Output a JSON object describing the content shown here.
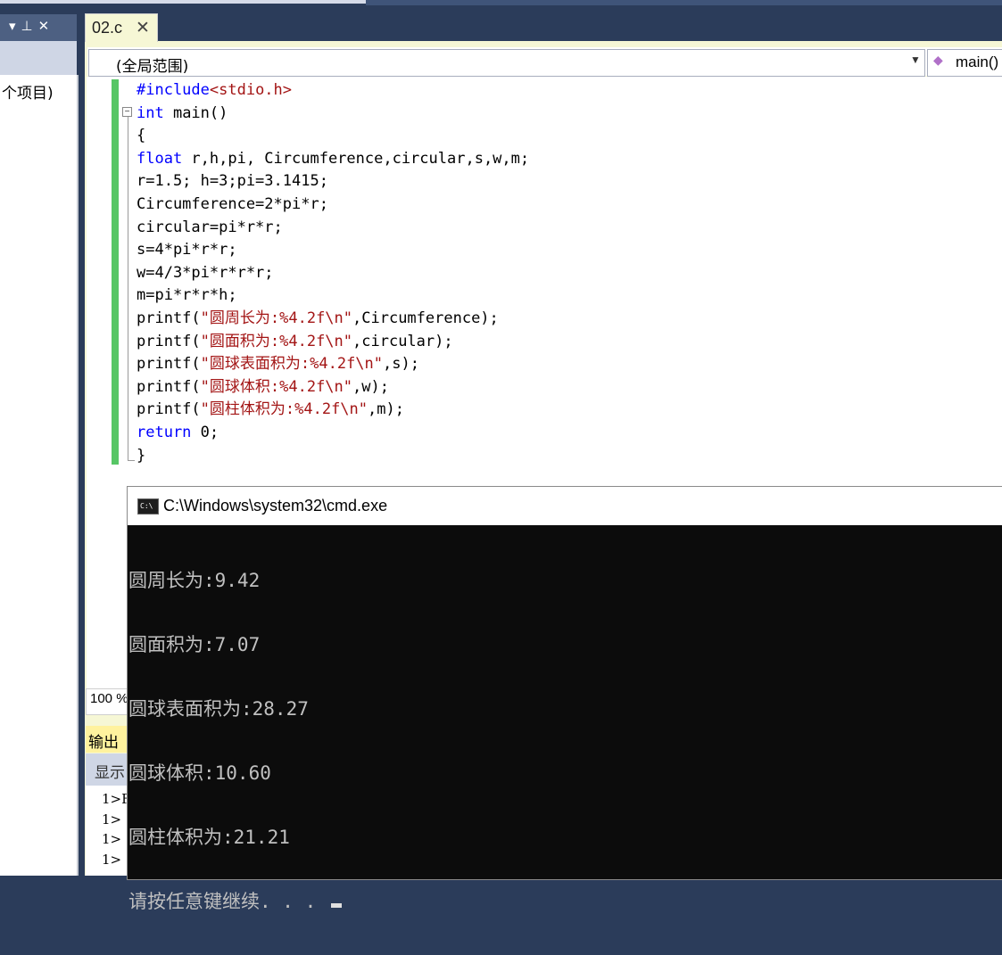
{
  "ide": {
    "tab": {
      "title": "02.c"
    },
    "scope": {
      "value": "(全局范围)"
    },
    "function": {
      "value": "main()"
    },
    "solution": {
      "label": "个项目)"
    },
    "zoom": "100 %",
    "output": {
      "title": "输出",
      "show_label": "显示",
      "lines": [
        "1>F",
        "1>",
        "1>",
        "1>"
      ]
    }
  },
  "code": {
    "lines": [
      [
        {
          "t": "#include",
          "c": "pp"
        },
        {
          "t": "<stdio.h>",
          "c": "inc"
        }
      ],
      [
        {
          "t": "int",
          "c": "kw"
        },
        {
          "t": " main()",
          "c": ""
        }
      ],
      [
        {
          "t": "{",
          "c": ""
        }
      ],
      [
        {
          "t": "float",
          "c": "kw"
        },
        {
          "t": " r,h,pi, Circumference,circular,s,w,m;",
          "c": ""
        }
      ],
      [
        {
          "t": "r=1.5; h=3;pi=3.1415;",
          "c": ""
        }
      ],
      [
        {
          "t": "Circumference=2*pi*r;",
          "c": ""
        }
      ],
      [
        {
          "t": "circular=pi*r*r;",
          "c": ""
        }
      ],
      [
        {
          "t": "s=4*pi*r*r;",
          "c": ""
        }
      ],
      [
        {
          "t": "w=4/3*pi*r*r*r;",
          "c": ""
        }
      ],
      [
        {
          "t": "m=pi*r*r*h;",
          "c": ""
        }
      ],
      [
        {
          "t": "printf(",
          "c": ""
        },
        {
          "t": "\"圆周长为:%4.2f\\n\"",
          "c": "str"
        },
        {
          "t": ",Circumference);",
          "c": ""
        }
      ],
      [
        {
          "t": "printf(",
          "c": ""
        },
        {
          "t": "\"圆面积为:%4.2f\\n\"",
          "c": "str"
        },
        {
          "t": ",circular);",
          "c": ""
        }
      ],
      [
        {
          "t": "printf(",
          "c": ""
        },
        {
          "t": "\"圆球表面积为:%4.2f\\n\"",
          "c": "str"
        },
        {
          "t": ",s);",
          "c": ""
        }
      ],
      [
        {
          "t": "printf(",
          "c": ""
        },
        {
          "t": "\"圆球体积:%4.2f\\n\"",
          "c": "str"
        },
        {
          "t": ",w);",
          "c": ""
        }
      ],
      [
        {
          "t": "printf(",
          "c": ""
        },
        {
          "t": "\"圆柱体积为:%4.2f\\n\"",
          "c": "str"
        },
        {
          "t": ",m);",
          "c": ""
        }
      ],
      [
        {
          "t": "return",
          "c": "kw"
        },
        {
          "t": " 0;",
          "c": ""
        }
      ],
      [
        {
          "t": "}",
          "c": ""
        }
      ]
    ]
  },
  "console": {
    "title": "C:\\Windows\\system32\\cmd.exe",
    "icon_text": "C:\\",
    "lines": [
      "圆周长为:9.42",
      "圆面积为:7.07",
      "圆球表面积为:28.27",
      "圆球体积:10.60",
      "圆柱体积为:21.21",
      "请按任意键继续. . . "
    ]
  }
}
